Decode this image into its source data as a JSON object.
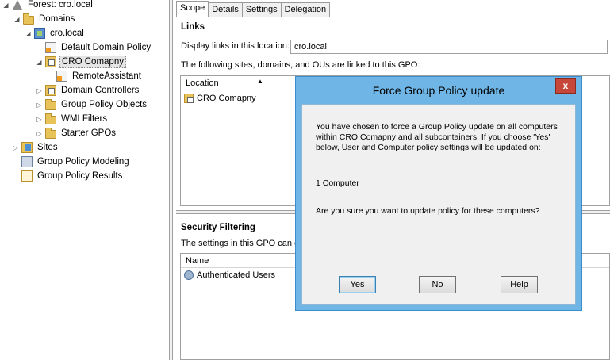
{
  "tree": {
    "forest": "Forest: cro.local",
    "domains": "Domains",
    "domain": "cro.local",
    "default_policy": "Default Domain Policy",
    "ou": "CRO Comapny",
    "remote": "RemoteAssistant",
    "domain_controllers": "Domain Controllers",
    "gpo_objects": "Group Policy Objects",
    "wmi": "WMI Filters",
    "starter": "Starter GPOs",
    "sites": "Sites",
    "modeling": "Group Policy Modeling",
    "results": "Group Policy Results"
  },
  "tabs": [
    "Scope",
    "Details",
    "Settings",
    "Delegation"
  ],
  "links": {
    "title": "Links",
    "display_label": "Display links in this location:",
    "display_value": "cro.local",
    "following_text": "The following sites, domains, and OUs are linked to this GPO:",
    "column": "Location",
    "rows": [
      "CRO Comapny"
    ]
  },
  "security": {
    "title": "Security Filtering",
    "desc": "The settings in this GPO can only apply",
    "column": "Name",
    "rows": [
      "Authenticated Users"
    ]
  },
  "dialog": {
    "title": "Force Group Policy update",
    "close": "x",
    "message": "You have chosen to force a Group Policy update on all computers within CRO Comapny and all subcontainers. If you choose 'Yes' below, User and Computer policy settings will be updated on:",
    "count": "1 Computer",
    "question": "Are you sure you want to update policy for these computers?",
    "yes": "Yes",
    "no": "No",
    "help": "Help"
  }
}
